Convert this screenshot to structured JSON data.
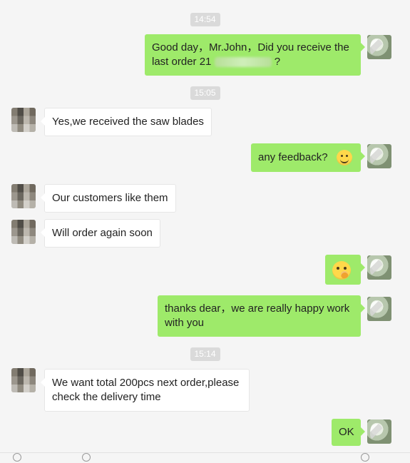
{
  "timestamps": [
    "14:54",
    "15:05",
    "15:14"
  ],
  "messages": [
    {
      "side": "self",
      "text": "Good day，Mr.John，Did you receive the last order 21"
    },
    {
      "side": "other",
      "text": "Yes,we received the saw blades"
    },
    {
      "side": "self",
      "text": "any feedback?",
      "emoji": "smile-emoji"
    },
    {
      "side": "other",
      "text": "Our customers like them"
    },
    {
      "side": "other",
      "text": "Will order again soon"
    },
    {
      "side": "self",
      "emoji": "thinking-emoji"
    },
    {
      "side": "self",
      "text": "thanks dear，we are really happy work with you"
    },
    {
      "side": "other",
      "text": "We want total 200pcs next order,please check the delivery time"
    },
    {
      "side": "self",
      "text": "OK"
    }
  ],
  "colors": {
    "self_bubble": "#9eea6a",
    "other_bubble": "#ffffff",
    "timestamp_bg": "#dadada",
    "background": "#f5f5f5"
  }
}
